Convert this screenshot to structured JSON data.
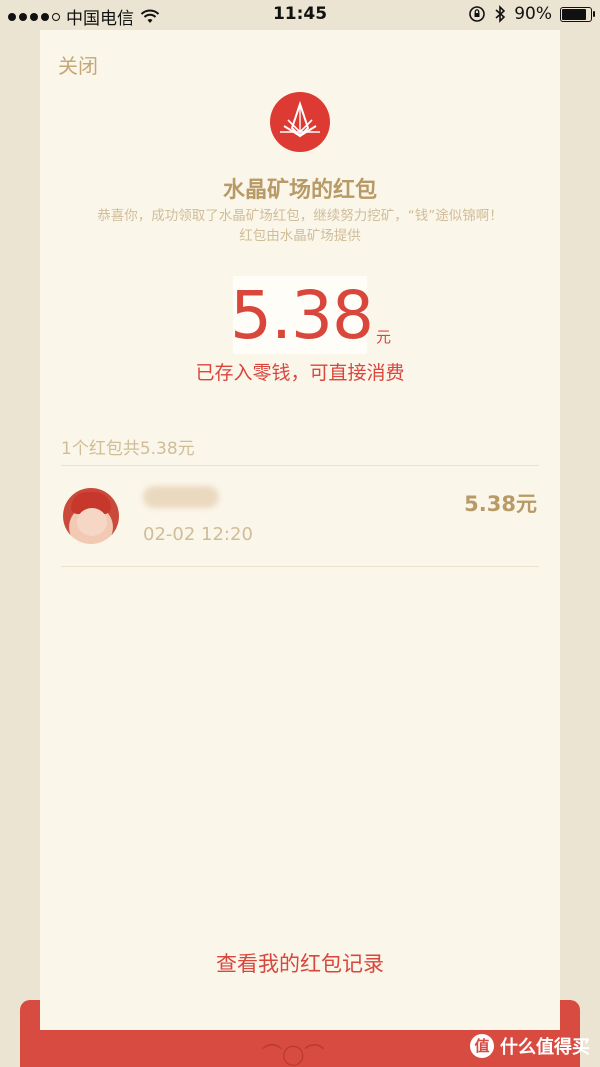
{
  "status_bar": {
    "carrier": "中国电信",
    "time": "11:45",
    "battery_percent": "90%",
    "battery_level": 0.9,
    "icons": [
      "signal-dots-icon",
      "wifi-icon",
      "orientation-lock-icon",
      "bluetooth-icon",
      "battery-icon"
    ]
  },
  "card": {
    "close_label": "关闭",
    "logo_icon": "crystal-mine-logo-icon",
    "title": "水晶矿场的红包",
    "subtitle_line1": "恭喜你，成功领取了水晶矿场红包，继续努力挖矿，“钱”途似锦啊！",
    "subtitle_line2": "红包由水晶矿场提供",
    "amount": "5.38",
    "amount_unit": "元",
    "stored_note": "已存入零钱，可直接消费",
    "summary": "1个红包共5.38元",
    "records": [
      {
        "time": "02-02 12:20",
        "amount": "5.38元"
      }
    ],
    "view_records_label": "查看我的红包记录"
  },
  "watermark": {
    "badge": "值",
    "text": "什么值得买"
  },
  "colors": {
    "background": "#ece4d2",
    "card": "#fbf6ea",
    "accent_red": "#d9463c",
    "gold_text": "#b89a66",
    "muted_text": "#d0bd98"
  }
}
